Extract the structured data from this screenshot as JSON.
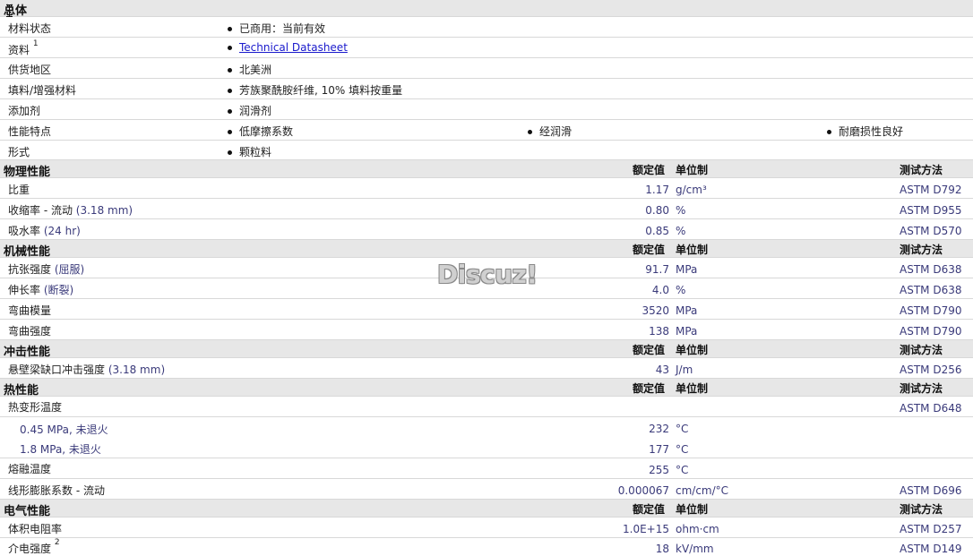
{
  "general": {
    "title": "总体",
    "rows": [
      {
        "label": "材料状态",
        "values": [
          "已商用：当前有效"
        ]
      },
      {
        "label": "资料",
        "sup": "1",
        "link": "Technical Datasheet"
      },
      {
        "label": "供货地区",
        "values": [
          "北美洲"
        ]
      },
      {
        "label": "填料/增强材料",
        "values": [
          "芳族聚酰胺纤维, 10% 填料按重量"
        ]
      },
      {
        "label": "添加剂",
        "values": [
          "润滑剂"
        ]
      },
      {
        "label": "性能特点",
        "values": [
          "低摩擦系数",
          "经润滑",
          "耐磨损性良好"
        ]
      },
      {
        "label": "形式",
        "values": [
          "颗粒料"
        ]
      }
    ]
  },
  "columns": {
    "nominal": "额定值",
    "unit": "单位制",
    "method": "测试方法"
  },
  "physical": {
    "title": "物理性能",
    "rows": [
      {
        "label": "比重",
        "paren": "",
        "value": "1.17",
        "unit": "g/cm³",
        "method": "ASTM D792"
      },
      {
        "label": "收缩率 - 流动",
        "paren": "(3.18 mm)",
        "value": "0.80",
        "unit": "%",
        "method": "ASTM D955"
      },
      {
        "label": "吸水率",
        "paren": "(24 hr)",
        "value": "0.85",
        "unit": "%",
        "method": "ASTM D570"
      }
    ]
  },
  "mechanical": {
    "title": "机械性能",
    "rows": [
      {
        "label": "抗张强度",
        "paren": "(屈服)",
        "value": "91.7",
        "unit": "MPa",
        "method": "ASTM D638"
      },
      {
        "label": "伸长率",
        "paren": "(断裂)",
        "value": "4.0",
        "unit": "%",
        "method": "ASTM D638"
      },
      {
        "label": "弯曲模量",
        "paren": "",
        "value": "3520",
        "unit": "MPa",
        "method": "ASTM D790"
      },
      {
        "label": "弯曲强度",
        "paren": "",
        "value": "138",
        "unit": "MPa",
        "method": "ASTM D790"
      }
    ]
  },
  "impact": {
    "title": "冲击性能",
    "rows": [
      {
        "label": "悬壁梁缺口冲击强度",
        "paren": "(3.18 mm)",
        "value": "43",
        "unit": "J/m",
        "method": "ASTM D256"
      }
    ]
  },
  "thermal": {
    "title": "热性能",
    "rows": [
      {
        "label": "热变形温度",
        "paren": "",
        "value": "",
        "unit": "",
        "method": "ASTM D648"
      },
      {
        "label": "0.45 MPa, 未退火",
        "paren": "",
        "value": "232",
        "unit": "°C",
        "method": ""
      },
      {
        "label": "1.8 MPa, 未退火",
        "paren": "",
        "value": "177",
        "unit": "°C",
        "method": ""
      },
      {
        "label": "熔融温度",
        "paren": "",
        "value": "255",
        "unit": "°C",
        "method": ""
      },
      {
        "label": "线形膨胀系数 - 流动",
        "paren": "",
        "value": "0.000067",
        "unit": "cm/cm/°C",
        "method": "ASTM D696"
      }
    ]
  },
  "electrical": {
    "title": "电气性能",
    "rows": [
      {
        "label": "体积电阻率",
        "paren": "",
        "value": "1.0E+15",
        "unit": "ohm·cm",
        "method": "ASTM D257"
      },
      {
        "label": "介电强度",
        "sup": "2",
        "paren": "",
        "value": "18",
        "unit": "kV/mm",
        "method": "ASTM D149"
      }
    ]
  },
  "watermark": "Discuz!"
}
